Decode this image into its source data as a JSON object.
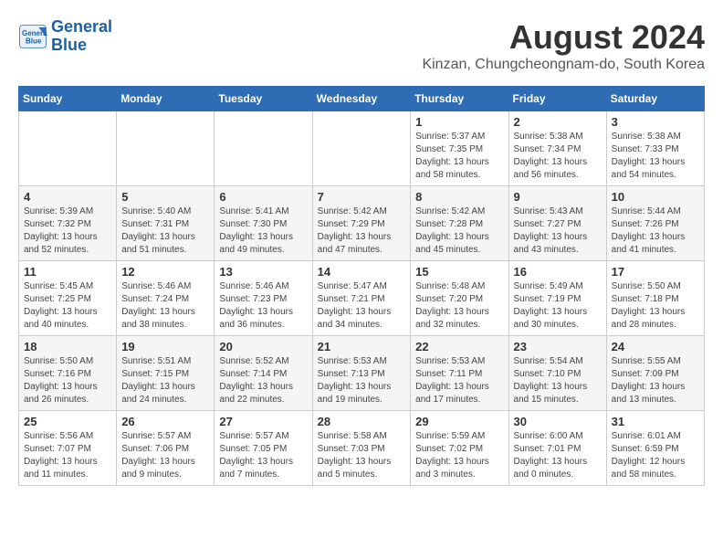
{
  "logo": {
    "line1": "General",
    "line2": "Blue"
  },
  "title": "August 2024",
  "subtitle": "Kinzan, Chungcheongnam-do, South Korea",
  "weekdays": [
    "Sunday",
    "Monday",
    "Tuesday",
    "Wednesday",
    "Thursday",
    "Friday",
    "Saturday"
  ],
  "weeks": [
    [
      {
        "day": "",
        "detail": ""
      },
      {
        "day": "",
        "detail": ""
      },
      {
        "day": "",
        "detail": ""
      },
      {
        "day": "",
        "detail": ""
      },
      {
        "day": "1",
        "detail": "Sunrise: 5:37 AM\nSunset: 7:35 PM\nDaylight: 13 hours\nand 58 minutes."
      },
      {
        "day": "2",
        "detail": "Sunrise: 5:38 AM\nSunset: 7:34 PM\nDaylight: 13 hours\nand 56 minutes."
      },
      {
        "day": "3",
        "detail": "Sunrise: 5:38 AM\nSunset: 7:33 PM\nDaylight: 13 hours\nand 54 minutes."
      }
    ],
    [
      {
        "day": "4",
        "detail": "Sunrise: 5:39 AM\nSunset: 7:32 PM\nDaylight: 13 hours\nand 52 minutes."
      },
      {
        "day": "5",
        "detail": "Sunrise: 5:40 AM\nSunset: 7:31 PM\nDaylight: 13 hours\nand 51 minutes."
      },
      {
        "day": "6",
        "detail": "Sunrise: 5:41 AM\nSunset: 7:30 PM\nDaylight: 13 hours\nand 49 minutes."
      },
      {
        "day": "7",
        "detail": "Sunrise: 5:42 AM\nSunset: 7:29 PM\nDaylight: 13 hours\nand 47 minutes."
      },
      {
        "day": "8",
        "detail": "Sunrise: 5:42 AM\nSunset: 7:28 PM\nDaylight: 13 hours\nand 45 minutes."
      },
      {
        "day": "9",
        "detail": "Sunrise: 5:43 AM\nSunset: 7:27 PM\nDaylight: 13 hours\nand 43 minutes."
      },
      {
        "day": "10",
        "detail": "Sunrise: 5:44 AM\nSunset: 7:26 PM\nDaylight: 13 hours\nand 41 minutes."
      }
    ],
    [
      {
        "day": "11",
        "detail": "Sunrise: 5:45 AM\nSunset: 7:25 PM\nDaylight: 13 hours\nand 40 minutes."
      },
      {
        "day": "12",
        "detail": "Sunrise: 5:46 AM\nSunset: 7:24 PM\nDaylight: 13 hours\nand 38 minutes."
      },
      {
        "day": "13",
        "detail": "Sunrise: 5:46 AM\nSunset: 7:23 PM\nDaylight: 13 hours\nand 36 minutes."
      },
      {
        "day": "14",
        "detail": "Sunrise: 5:47 AM\nSunset: 7:21 PM\nDaylight: 13 hours\nand 34 minutes."
      },
      {
        "day": "15",
        "detail": "Sunrise: 5:48 AM\nSunset: 7:20 PM\nDaylight: 13 hours\nand 32 minutes."
      },
      {
        "day": "16",
        "detail": "Sunrise: 5:49 AM\nSunset: 7:19 PM\nDaylight: 13 hours\nand 30 minutes."
      },
      {
        "day": "17",
        "detail": "Sunrise: 5:50 AM\nSunset: 7:18 PM\nDaylight: 13 hours\nand 28 minutes."
      }
    ],
    [
      {
        "day": "18",
        "detail": "Sunrise: 5:50 AM\nSunset: 7:16 PM\nDaylight: 13 hours\nand 26 minutes."
      },
      {
        "day": "19",
        "detail": "Sunrise: 5:51 AM\nSunset: 7:15 PM\nDaylight: 13 hours\nand 24 minutes."
      },
      {
        "day": "20",
        "detail": "Sunrise: 5:52 AM\nSunset: 7:14 PM\nDaylight: 13 hours\nand 22 minutes."
      },
      {
        "day": "21",
        "detail": "Sunrise: 5:53 AM\nSunset: 7:13 PM\nDaylight: 13 hours\nand 19 minutes."
      },
      {
        "day": "22",
        "detail": "Sunrise: 5:53 AM\nSunset: 7:11 PM\nDaylight: 13 hours\nand 17 minutes."
      },
      {
        "day": "23",
        "detail": "Sunrise: 5:54 AM\nSunset: 7:10 PM\nDaylight: 13 hours\nand 15 minutes."
      },
      {
        "day": "24",
        "detail": "Sunrise: 5:55 AM\nSunset: 7:09 PM\nDaylight: 13 hours\nand 13 minutes."
      }
    ],
    [
      {
        "day": "25",
        "detail": "Sunrise: 5:56 AM\nSunset: 7:07 PM\nDaylight: 13 hours\nand 11 minutes."
      },
      {
        "day": "26",
        "detail": "Sunrise: 5:57 AM\nSunset: 7:06 PM\nDaylight: 13 hours\nand 9 minutes."
      },
      {
        "day": "27",
        "detail": "Sunrise: 5:57 AM\nSunset: 7:05 PM\nDaylight: 13 hours\nand 7 minutes."
      },
      {
        "day": "28",
        "detail": "Sunrise: 5:58 AM\nSunset: 7:03 PM\nDaylight: 13 hours\nand 5 minutes."
      },
      {
        "day": "29",
        "detail": "Sunrise: 5:59 AM\nSunset: 7:02 PM\nDaylight: 13 hours\nand 3 minutes."
      },
      {
        "day": "30",
        "detail": "Sunrise: 6:00 AM\nSunset: 7:01 PM\nDaylight: 13 hours\nand 0 minutes."
      },
      {
        "day": "31",
        "detail": "Sunrise: 6:01 AM\nSunset: 6:59 PM\nDaylight: 12 hours\nand 58 minutes."
      }
    ]
  ]
}
